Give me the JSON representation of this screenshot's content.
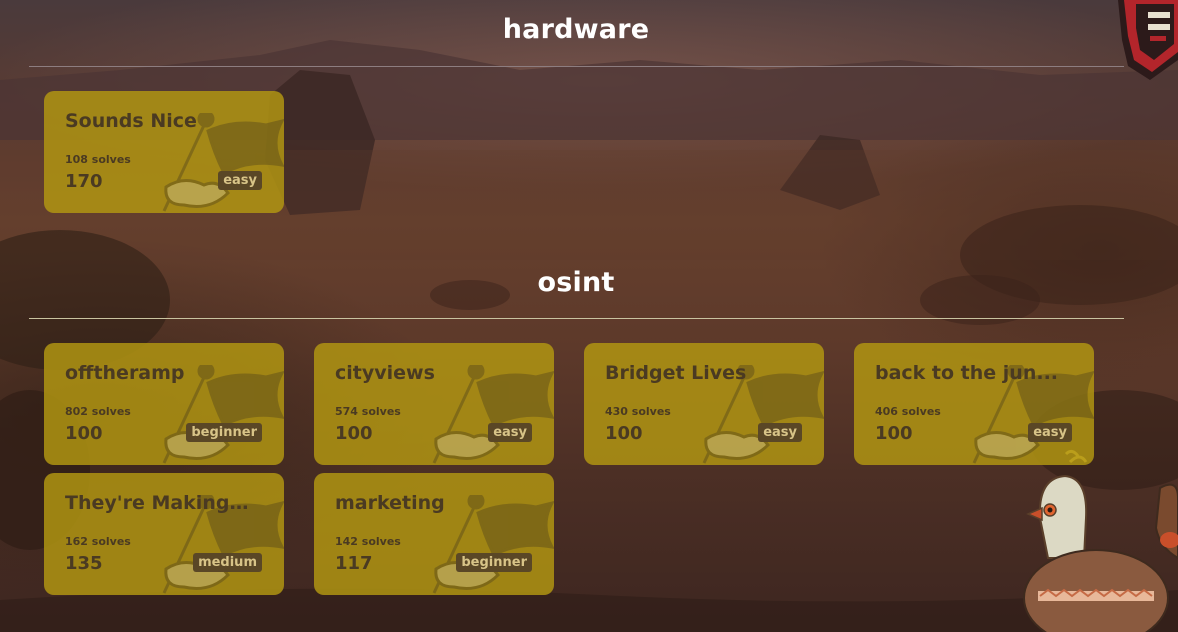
{
  "sections": [
    {
      "title": "hardware",
      "challenges": [
        {
          "name": "Sounds Nice",
          "solves": "108 solves",
          "points": "170",
          "difficulty": "easy"
        }
      ]
    },
    {
      "title": "osint",
      "challenges": [
        {
          "name": "offtheramp",
          "solves": "802 solves",
          "points": "100",
          "difficulty": "beginner"
        },
        {
          "name": "cityviews",
          "solves": "574 solves",
          "points": "100",
          "difficulty": "easy"
        },
        {
          "name": "Bridget Lives",
          "solves": "430 solves",
          "points": "100",
          "difficulty": "easy"
        },
        {
          "name": "back to the jun...",
          "solves": "406 solves",
          "points": "100",
          "difficulty": "easy"
        },
        {
          "name": "They're Making...",
          "solves": "162 solves",
          "points": "135",
          "difficulty": "medium"
        },
        {
          "name": "marketing",
          "solves": "142 solves",
          "points": "117",
          "difficulty": "beginner"
        }
      ]
    }
  ],
  "colors": {
    "card_bg": "#b29612",
    "card_text": "#4a3a22",
    "badge_bg": "#5a4726",
    "badge_text": "#d8c488",
    "divider": "#c9c3a0"
  },
  "icons": [
    "flag-icon",
    "totem-mascot",
    "bird-mascot"
  ]
}
